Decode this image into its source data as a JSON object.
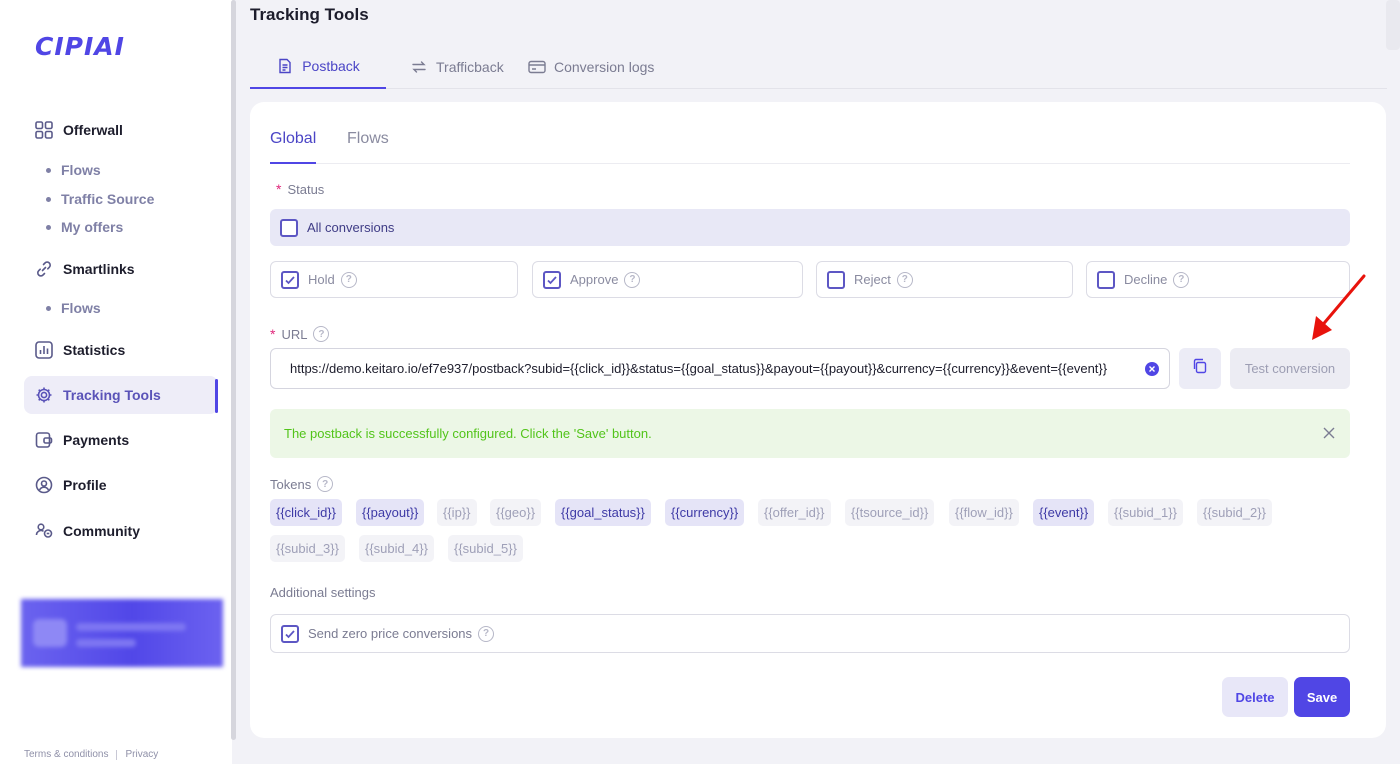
{
  "app": {
    "logo_text": "CIPIAI"
  },
  "sidebar": {
    "items": [
      {
        "label": "Offerwall",
        "icon": "grid-icon"
      },
      {
        "label": "Smartlinks",
        "icon": "link-icon"
      },
      {
        "label": "Statistics",
        "icon": "bar-chart-icon"
      },
      {
        "label": "Tracking Tools",
        "icon": "gear-icon",
        "active": true
      },
      {
        "label": "Payments",
        "icon": "wallet-icon"
      },
      {
        "label": "Profile",
        "icon": "user-circle-icon"
      },
      {
        "label": "Community",
        "icon": "community-icon"
      }
    ],
    "offerwall_sub": [
      "Flows",
      "Traffic Source",
      "My offers"
    ],
    "smartlinks_sub": [
      "Flows"
    ],
    "footer": {
      "terms": "Terms & conditions",
      "privacy": "Privacy"
    }
  },
  "header": {
    "title": "Tracking Tools"
  },
  "top_tabs": [
    {
      "label": "Postback",
      "icon": "document-icon",
      "active": true
    },
    {
      "label": "Trafficback",
      "icon": "swap-arrows-icon"
    },
    {
      "label": "Conversion logs",
      "icon": "card-icon"
    }
  ],
  "sub_tabs": [
    {
      "label": "Global",
      "active": true
    },
    {
      "label": "Flows"
    }
  ],
  "status": {
    "label": "Status",
    "all_conversions": "All conversions",
    "options": [
      {
        "label": "Hold",
        "checked": true
      },
      {
        "label": "Approve",
        "checked": true
      },
      {
        "label": "Reject",
        "checked": false
      },
      {
        "label": "Decline",
        "checked": false
      }
    ]
  },
  "url": {
    "label": "URL",
    "value": "https://demo.keitaro.io/ef7e937/postback?subid={{click_id}}&status={{goal_status}}&payout={{payout}}&currency={{currency}}&event={{event}}",
    "test_button": "Test conversion"
  },
  "success_message": "The postback is successfully configured. Click the 'Save' button.",
  "tokens": {
    "label": "Tokens",
    "items": [
      {
        "text": "{{click_id}}",
        "used": true
      },
      {
        "text": "{{payout}}",
        "used": true
      },
      {
        "text": "{{ip}}",
        "used": false
      },
      {
        "text": "{{geo}}",
        "used": false
      },
      {
        "text": "{{goal_status}}",
        "used": true
      },
      {
        "text": "{{currency}}",
        "used": true
      },
      {
        "text": "{{offer_id}}",
        "used": false
      },
      {
        "text": "{{tsource_id}}",
        "used": false
      },
      {
        "text": "{{flow_id}}",
        "used": false
      },
      {
        "text": "{{event}}",
        "used": true
      },
      {
        "text": "{{subid_1}}",
        "used": false
      },
      {
        "text": "{{subid_2}}",
        "used": false
      },
      {
        "text": "{{subid_3}}",
        "used": false
      },
      {
        "text": "{{subid_4}}",
        "used": false
      },
      {
        "text": "{{subid_5}}",
        "used": false
      }
    ]
  },
  "additional": {
    "label": "Additional settings",
    "zero_price": {
      "label": "Send zero price conversions",
      "checked": true
    }
  },
  "actions": {
    "delete": "Delete",
    "save": "Save"
  },
  "colors": {
    "accent": "#5046e5",
    "success": "#52c41a",
    "required": "#e0267a",
    "annotation_arrow": "#e8130c"
  }
}
